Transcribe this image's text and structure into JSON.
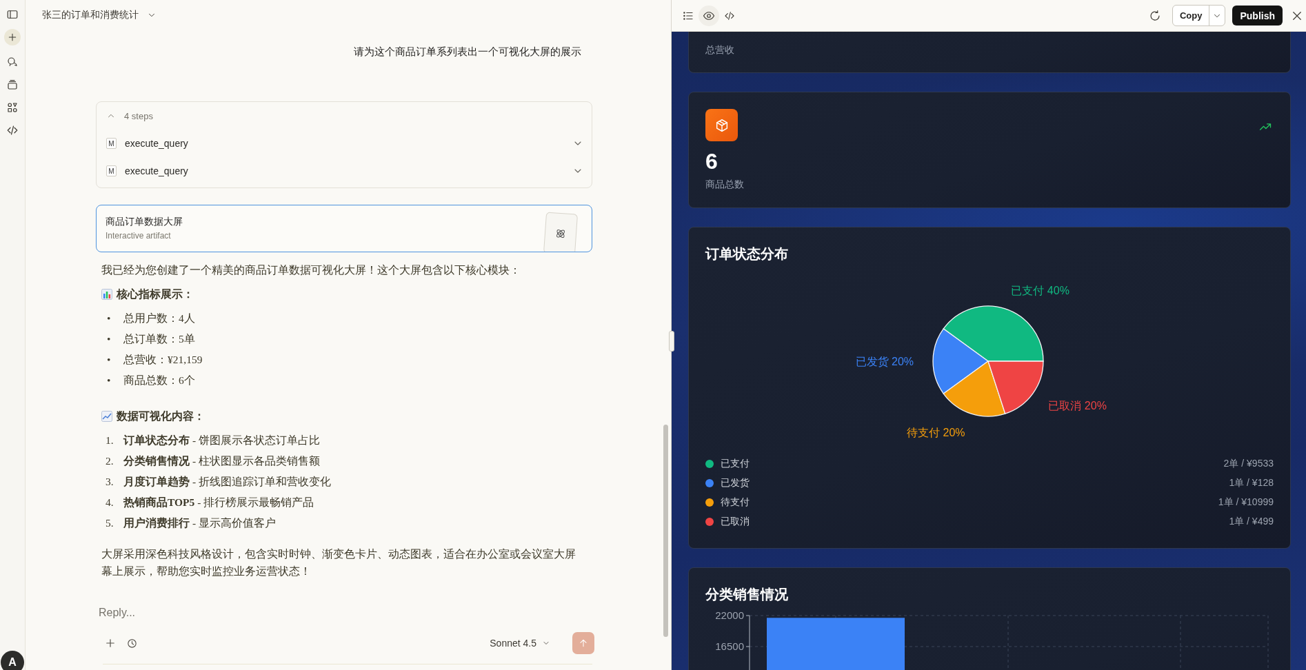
{
  "conversation": {
    "title": "张三的订单和消费统计"
  },
  "rail": {
    "avatar": "A"
  },
  "user_message": "请为这个商品订单系列表出一个可视化大屏的展示",
  "steps": {
    "summary": "4 steps",
    "expanded": true,
    "items": [
      {
        "badge": "M",
        "tool": "execute_query",
        "expanded": false
      },
      {
        "badge": "M",
        "tool": "execute_query",
        "expanded": false
      }
    ]
  },
  "artifact": {
    "title": "商品订单数据大屏",
    "subtitle": "Interactive artifact"
  },
  "reply": {
    "intro": "我已经为您创建了一个精美的商品订单数据可视化大屏！这个大屏包含以下核心模块：",
    "sections": [
      {
        "kind": "bullets",
        "heading": "核心指标展示：",
        "items": [
          {
            "marker": "•",
            "text": "总用户数：4人"
          },
          {
            "marker": "•",
            "text": "总订单数：5单"
          },
          {
            "marker": "•",
            "text": "总营收：¥21,159"
          },
          {
            "marker": "•",
            "text": "商品总数：6个"
          }
        ]
      },
      {
        "kind": "numbered",
        "heading": "数据可视化内容：",
        "items": [
          {
            "marker": "1.",
            "text": "**订单状态分布** - 饼图展示各状态订单占比"
          },
          {
            "marker": "2.",
            "text": "**分类销售情况** - 柱状图显示各品类销售额"
          },
          {
            "marker": "3.",
            "text": "**月度订单趋势** - 折线图追踪订单和营收变化"
          },
          {
            "marker": "4.",
            "text": "**热销商品TOP5** - 排行榜展示最畅销产品"
          },
          {
            "marker": "5.",
            "text": "**用户消费排行** - 显示高价值客户"
          }
        ]
      }
    ],
    "closing": "大屏采用深色科技风格设计，包含实时时钟、渐变色卡片、动态图表，适合在办公室或会议室大屏幕上展示，帮助您实时监控业务运营状态！"
  },
  "composer": {
    "placeholder": "Reply...",
    "model": "Sonnet 4.5"
  },
  "artifact_panel": {
    "tabs": [
      {
        "kind": "preview",
        "selected": true
      },
      {
        "kind": "code",
        "selected": false
      }
    ],
    "copy": "Copy",
    "publish": "Publish",
    "cards": [
      {
        "kind": "cut_metric",
        "label": "总营收"
      },
      {
        "kind": "metric",
        "value": "6",
        "label": "商品总数"
      }
    ],
    "status_chart": {
      "title": "订单状态分布",
      "chart_data": {
        "type": "pie",
        "values": [
          40,
          20,
          20,
          20
        ],
        "value_labels": [
          "已支付 40%",
          "已发货 20%",
          "待支付 20%",
          "已取消 20%"
        ]
      },
      "legend": [
        {
          "name": "已支付",
          "color": "#10b981",
          "detail": "2单 / ¥9533"
        },
        {
          "name": "已发货",
          "color": "#3b82f6",
          "detail": "1单 / ¥128"
        },
        {
          "name": "待支付",
          "color": "#f59e0b",
          "detail": "1单 / ¥10999"
        },
        {
          "name": "已取消",
          "color": "#ef4444",
          "detail": "1单 / ¥499"
        }
      ]
    },
    "sales_chart": {
      "title": "分类销售情况",
      "chart_data": {
        "type": "bar",
        "ylim": [
          0,
          22000
        ],
        "yticks": [
          16500,
          22000
        ],
        "series": [
          {
            "color": "#3b82f6",
            "values": [
              21600
            ]
          }
        ]
      }
    }
  }
}
